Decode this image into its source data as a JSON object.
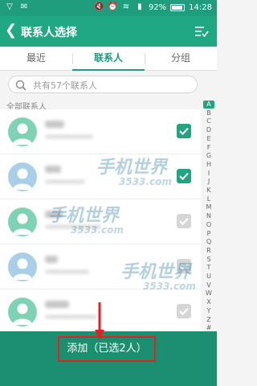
{
  "status_bar": {
    "battery": "92%",
    "battery_level": 0.92,
    "time": "14:28"
  },
  "app_bar": {
    "title": "联系人选择"
  },
  "tabs": [
    {
      "label": "最近",
      "active": false
    },
    {
      "label": "联系人",
      "active": true
    },
    {
      "label": "分组",
      "active": false
    }
  ],
  "search": {
    "placeholder": "共有57个联系人"
  },
  "section_label": "全部联系人",
  "contacts": [
    {
      "checked": true,
      "avatar_color": "#7fd3b5"
    },
    {
      "checked": true,
      "avatar_color": "#a9cfe8"
    },
    {
      "checked": false,
      "avatar_color": "#7fd3b5"
    },
    {
      "checked": false,
      "avatar_color": "#a9cfe8"
    },
    {
      "checked": false,
      "avatar_color": "#7fd3b5"
    },
    {
      "checked": false,
      "avatar_color": "#a9cfe8"
    }
  ],
  "index_letters": [
    "A",
    "B",
    "C",
    "D",
    "E",
    "F",
    "G",
    "H",
    "I",
    "J",
    "K",
    "L",
    "M",
    "N",
    "O",
    "P",
    "Q",
    "R",
    "S",
    "T",
    "U",
    "V",
    "W",
    "X",
    "Y",
    "Z",
    "#"
  ],
  "index_selected": "A",
  "watermark": {
    "text": "手机世界",
    "number": "3533.com"
  },
  "add_button": {
    "label": "添加（已选2人）"
  },
  "colors": {
    "status_bar": "#1f9d7d",
    "app_bar": "#20a883",
    "accent": "#22a382",
    "bottom_bar": "#1b8f70",
    "annotation_red": "#e22222"
  }
}
